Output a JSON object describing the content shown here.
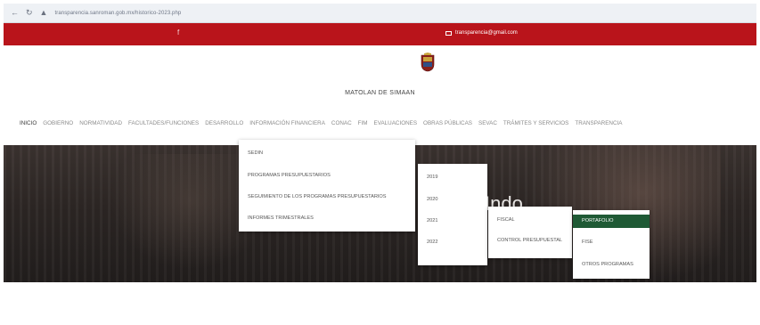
{
  "browser": {
    "url": "transparencia.sanroman.gob.mx/historico-2023.php",
    "icons": [
      "back-icon",
      "reload-icon",
      "lock-icon"
    ]
  },
  "topbar": {
    "color": "#b9141b",
    "facebook_icon": "facebook-icon",
    "email": "transparencia@gmail.com"
  },
  "header": {
    "title": "MATOLAN DE SIMAAN",
    "logo_icon": "municipal-seal-icon"
  },
  "nav": {
    "items": [
      "INICIO",
      "GOBIERNO",
      "NORMATIVIDAD",
      "FACULTADES/FUNCIONES",
      "DESARROLLO",
      "INFORMACIÓN FINANCIERA",
      "CONAC",
      "FIM",
      "EVALUACIONES",
      "OBRAS PÚBLICAS",
      "SEVAC",
      "TRÁMITES Y SERVICIOS",
      "TRANSPARENCIA"
    ]
  },
  "hero": {
    "title": "Indo"
  },
  "menus": {
    "level1": [
      "SEDIN",
      "PROGRAMAS PRESUPUESTARIOS",
      "SEGUIMIENTO DE LOS PROGRAMAS PRESUPUESTARIOS",
      "INFORMES TRIMESTRALES"
    ],
    "level2": [
      "2019",
      "2020",
      "2021",
      "2022"
    ],
    "level3": [
      "FISCAL",
      "CONTROL PRESUPUESTAL"
    ],
    "level4": [
      "PORTAFOLIO",
      "FISE",
      "OTROS PROGRAMAS"
    ],
    "highlight_color": "#1f5a35"
  }
}
